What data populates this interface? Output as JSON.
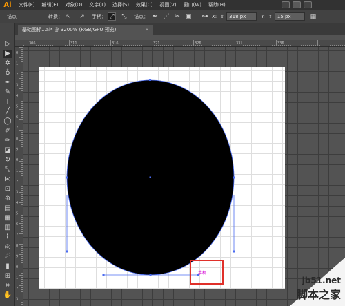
{
  "app": {
    "logo": "Ai"
  },
  "menu": [
    "文件(F)",
    "编辑(E)",
    "对象(O)",
    "文字(T)",
    "选择(S)",
    "效果(C)",
    "视图(V)",
    "窗口(W)",
    "帮助(H)"
  ],
  "control": {
    "anchor_label": "锚点",
    "convert_label": "转换：",
    "handle_label": "手柄：",
    "anchor2_label": "锚点：",
    "x_label": "X:",
    "x_value": "318 px",
    "y_label": "Y:",
    "y_value": "15 px"
  },
  "tab": {
    "title": "基础图标1.ai* @ 3200% (RGB/GPU 预览)",
    "close": "×"
  },
  "ruler_top": [
    "306",
    "311",
    "316",
    "321",
    "326",
    "331",
    "336"
  ],
  "ruler_left": [
    "0",
    "1",
    "2",
    "3",
    "4",
    "5",
    "6",
    "7",
    "8",
    "9",
    "0",
    "1",
    "2",
    "3",
    "4",
    "5",
    "6",
    "7",
    "8",
    "9",
    "0",
    "1",
    "2",
    "3"
  ],
  "canvas": {
    "handle_label": "手柄"
  },
  "colors": {
    "selection": "#4b6cf0",
    "highlight_box": "#e0302a",
    "handle_text": "#d400d4",
    "logo": "#ff9a00"
  },
  "watermark": {
    "url": "jb51.net",
    "name": "脚本之家"
  }
}
